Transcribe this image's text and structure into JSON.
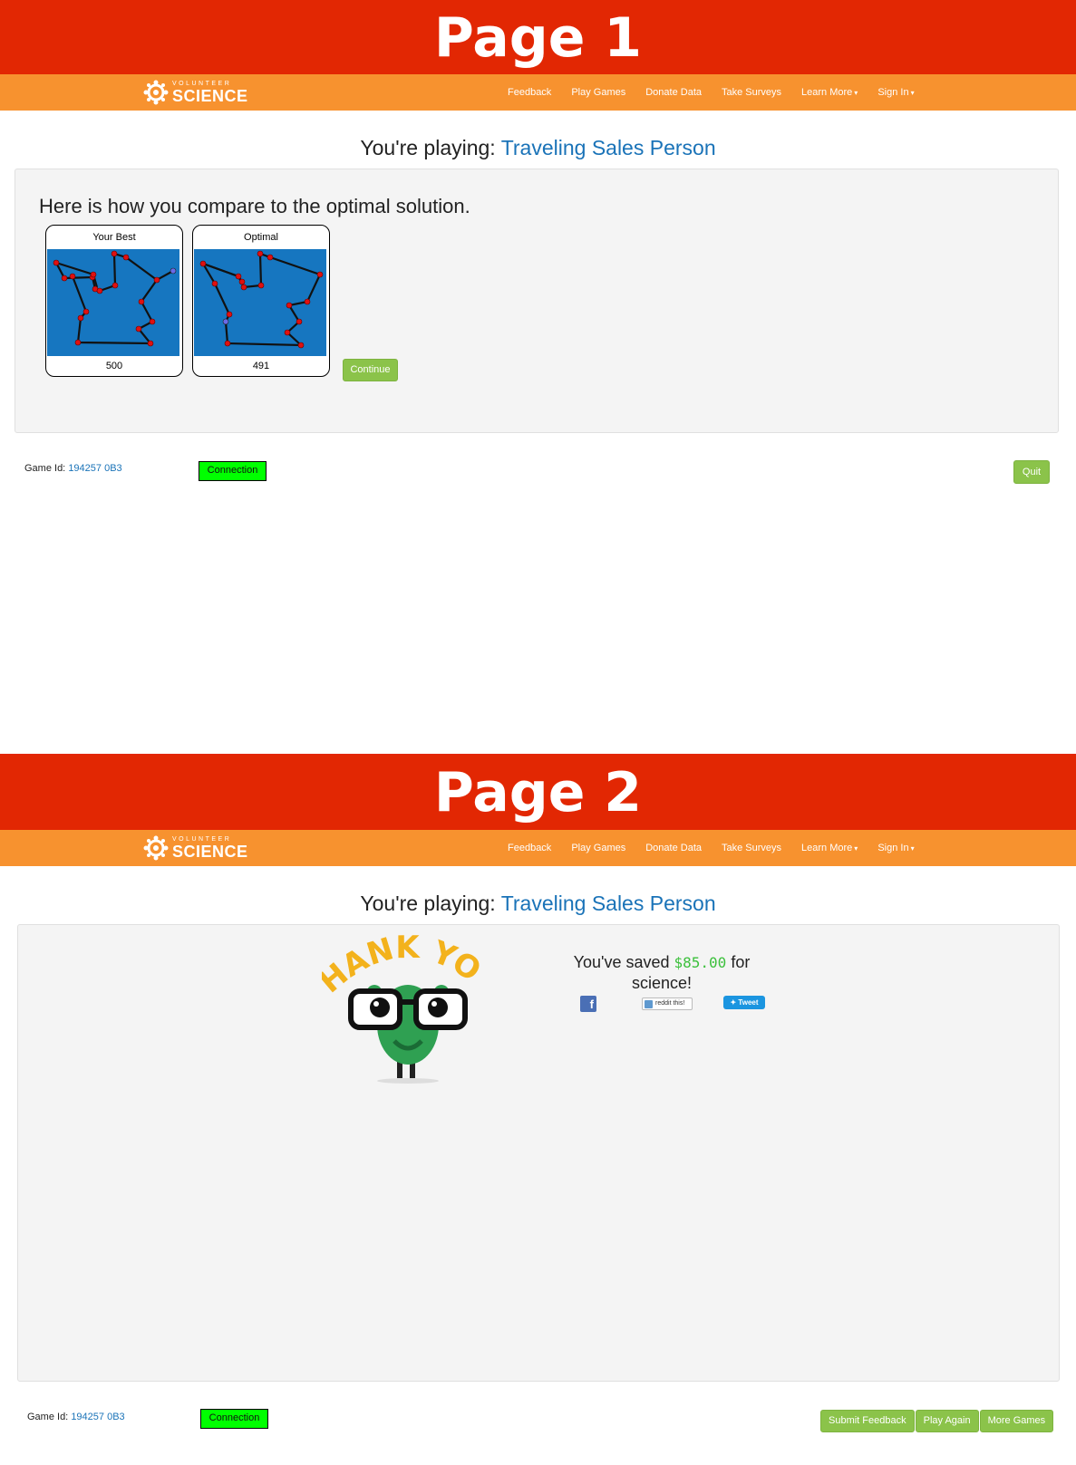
{
  "pages": [
    {
      "banner": "Page 1"
    },
    {
      "banner": "Page 2"
    }
  ],
  "nav": {
    "logo_top": "VOLUNTEER",
    "logo_bottom": "SCIENCE",
    "links": [
      "Feedback",
      "Play Games",
      "Donate Data",
      "Take Surveys",
      "Learn More",
      "Sign In"
    ]
  },
  "playing": {
    "prefix": "You're playing:",
    "game": "Traveling Sales Person"
  },
  "compare": {
    "heading": "Here is how you compare to the optimal solution.",
    "your_best": {
      "title": "Your Best",
      "score": "500"
    },
    "optimal": {
      "title": "Optimal",
      "score": "491"
    },
    "continue_label": "Continue"
  },
  "footer": {
    "game_id_label": "Game Id:",
    "game_id": "194257 0B3",
    "connection_label": "Connection",
    "quit_label": "Quit"
  },
  "thanks": {
    "banner_text": "THANK YOU!",
    "saved_prefix": "You've saved",
    "amount": "$85.00",
    "saved_suffix": "for science!",
    "facebook": "f",
    "reddit": "reddit this!",
    "tweet": "Tweet"
  },
  "bottom_buttons": [
    "Submit Feedback",
    "Play Again",
    "More Games"
  ],
  "colors": {
    "banner": "#e22703",
    "navbar": "#f7922f",
    "map_bg": "#1676c0",
    "link": "#1a73b8",
    "button": "#8bc34a",
    "connection": "#00ff00"
  },
  "icons": {
    "logo": "volunteer-science-logo",
    "fb": "facebook-icon",
    "reddit": "reddit-icon",
    "twitter": "twitter-icon",
    "mascot": "thank-you-mascot"
  }
}
